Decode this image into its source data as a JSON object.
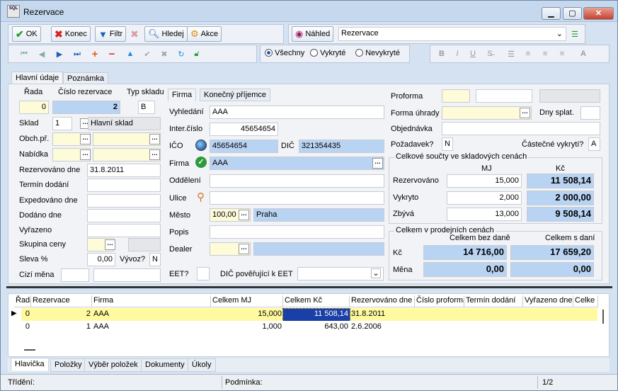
{
  "window": {
    "title": "Rezervace",
    "icon_text": "SQL"
  },
  "toolbar": {
    "ok": "OK",
    "konec": "Konec",
    "filtr": "Filtr",
    "hledej": "Hledej",
    "akce": "Akce",
    "nahled": "Náhled",
    "report_value": "Rezervace"
  },
  "filter": {
    "vsechny": "Všechny",
    "vykryte": "Vykryté",
    "nevykryte": "Nevykryté",
    "selected": "Všechny"
  },
  "tabs": {
    "hlavni": "Hlavní údaje",
    "poznamka": "Poznámka",
    "firma": "Firma",
    "konecny": "Konečný příjemce"
  },
  "left": {
    "rada_l": "Řada",
    "cislo_l": "Číslo rezervace",
    "typ_l": "Typ skladu",
    "rada": "0",
    "cislo": "2",
    "typ": "B",
    "sklad_l": "Sklad",
    "sklad": "1",
    "sklad_name": "Hlavní sklad",
    "obch_l": "Obch.př.",
    "nabidka_l": "Nabídka",
    "rez_dne_l": "Rezervováno dne",
    "rez_dne": "31.8.2011",
    "termin_l": "Termín dodání",
    "exped_l": "Expedováno dne",
    "dodano_l": "Dodáno dne",
    "vyrazeno_l": "Vyřazeno",
    "skupina_l": "Skupina ceny",
    "sleva_l": "Sleva %",
    "sleva": "0,00",
    "vyvoz_l": "Vývoz?",
    "vyvoz": "N",
    "mena_l": "Cizí měna"
  },
  "mid": {
    "vyhledani_l": "Vyhledání",
    "vyhledani": "AAA",
    "inter_l": "Inter.číslo",
    "inter": "45654654",
    "ico_l": "IČO",
    "ico": "45654654",
    "dic_l": "DIČ",
    "dic": "321354435",
    "firma_l": "Firma",
    "firma": "AAA",
    "oddeleni_l": "Oddělení",
    "ulice_l": "Ulice",
    "mesto_l": "Město",
    "psc": "100,00",
    "mesto": "Praha",
    "popis_l": "Popis",
    "dealer_l": "Dealer",
    "eet_l": "EET?",
    "dic_eet_l": "DIČ pověřující k EET"
  },
  "right": {
    "proforma_l": "Proforma",
    "forma_l": "Forma úhrady",
    "dny_l": "Dny splat.",
    "objednavka_l": "Objednávka",
    "pozadavek_l": "Požadavek?",
    "pozadavek": "N",
    "castecne_l": "Částečné vykrytí?",
    "castecne": "A",
    "grp1": "Celkové součty ve skladových cenách",
    "mj_h": "MJ",
    "kc_h": "Kč",
    "rez_l": "Rezervováno",
    "rez_mj": "15,000",
    "rez_kc": "11 508,14",
    "vyk_l": "Vykryto",
    "vyk_mj": "2,000",
    "vyk_kc": "2 000,00",
    "zby_l": "Zbývá",
    "zby_mj": "13,000",
    "zby_kc": "9 508,14",
    "grp2": "Celkem v prodejních cenách",
    "bez_h": "Celkem bez daně",
    "s_h": "Celkem s daní",
    "kc_l": "Kč",
    "kc_bez": "14 716,00",
    "kc_s": "17 659,20",
    "mena_l": "Měna",
    "mena_bez": "0,00",
    "mena_s": "0,00"
  },
  "grid": {
    "headers": [
      "Řada",
      "Rezervace",
      "Firma",
      "Celkem MJ",
      "Celkem Kč",
      "Rezervováno dne",
      "Číslo proforma",
      "Termín dodání",
      "Vyřazeno dne",
      "Celke"
    ],
    "rows": [
      [
        "0",
        "2",
        "AAA",
        "15,000",
        "11 508,14",
        "31.8.2011"
      ],
      [
        "0",
        "1",
        "AAA",
        "1,000",
        "643,00",
        "2.6.2006"
      ]
    ]
  },
  "bottom_tabs": [
    "Hlavička",
    "Položky",
    "Výběr položek",
    "Dokumenty",
    "Úkoly"
  ],
  "status": {
    "trideni": "Třídění:",
    "podminka": "Podmínka:",
    "page": "1/2"
  }
}
